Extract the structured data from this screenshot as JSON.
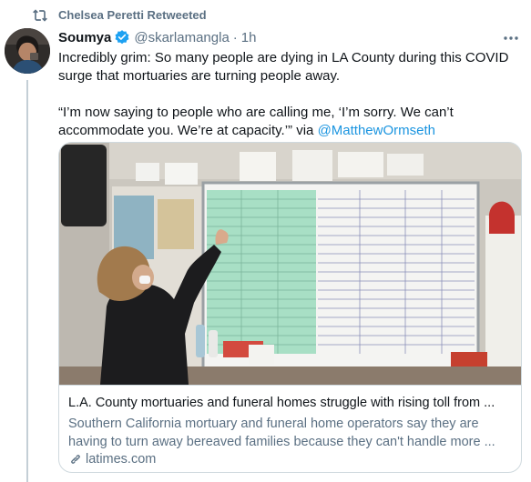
{
  "retweet": {
    "icon": "retweet-icon",
    "label": "Chelsea Peretti Retweeted"
  },
  "tweet": {
    "author": {
      "display_name": "Soumya",
      "verified": true,
      "handle": "@skarlamangla",
      "separator": "·",
      "time": "1h"
    },
    "text_line1": "Incredibly grim: So many people are dying in LA County during this COVID surge that mortuaries are turning people away.",
    "text_line2_quote": "“I’m now saying to people who are calling me, ‘I’m sorry. We can’t accommodate you. We’re at capacity.’” via ",
    "mention": "@MatthewOrmseth"
  },
  "card": {
    "title": "L.A. County mortuaries and funeral homes struggle with rising toll from ...",
    "description": "Southern California mortuary and funeral home operators say they are having to turn away bereaved families because they can't handle more ...",
    "domain": "latimes.com"
  },
  "colors": {
    "accent": "#1b95e0",
    "muted": "#5b7083",
    "text": "#0f1419",
    "border": "#cfd9de",
    "verified": "#1da1f2"
  }
}
